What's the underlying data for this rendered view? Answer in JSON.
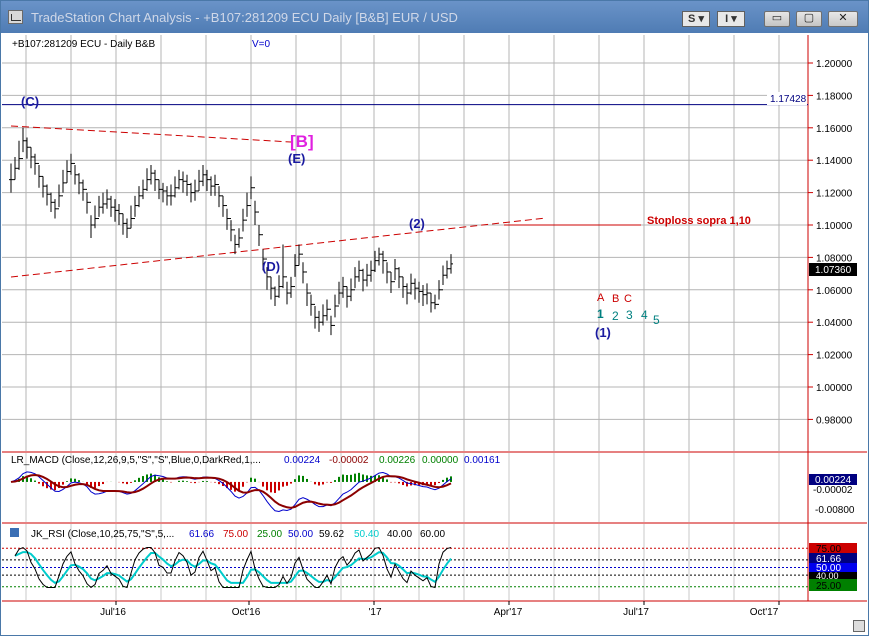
{
  "window": {
    "title": "TradeStation Chart Analysis - +B107:281209 ECU Daily [B&B] EUR / USD",
    "btn_s": "S",
    "btn_i": "I",
    "btn_min": "▭",
    "btn_max": "▢",
    "btn_close": "✕"
  },
  "colors": {
    "grid": "#b0b0b0",
    "price_bars": "#000000",
    "resistance": "#000080",
    "trendline": "#cc0000",
    "wave_label": "#1a1aa0",
    "wave_b": "#e020e0",
    "teal": "#008080",
    "red_label": "#cc0000"
  },
  "chart_data": [
    {
      "type": "ohlc",
      "panel": "price",
      "header": {
        "symbol": "+B107:281209 ECU - Daily  B&B",
        "v": "V=0"
      },
      "yaxis": {
        "ticks": [
          "1.20000",
          "1.18000",
          "1.16000",
          "1.14000",
          "1.12000",
          "1.10000",
          "1.08000",
          "1.06000",
          "1.04000",
          "1.02000",
          "1.00000",
          "0.98000"
        ],
        "ylim": [
          0.968,
          1.218
        ]
      },
      "xaxis": {
        "ticks": [
          "Jul'16",
          "Oct'16",
          "'17",
          "Apr'17",
          "Jul'17",
          "Oct'17"
        ]
      },
      "grid": true,
      "series": {
        "x": [
          0,
          2,
          4,
          6,
          8,
          10,
          12,
          14,
          16,
          18,
          20,
          22,
          24,
          26,
          28,
          30,
          32,
          34,
          36,
          38,
          40,
          42,
          44,
          46,
          48,
          50,
          52,
          54,
          56,
          58,
          60,
          62,
          64,
          66,
          68,
          70,
          72,
          74,
          76,
          78,
          80,
          82,
          84,
          86,
          88,
          90,
          92,
          94,
          96,
          98,
          100,
          102,
          104,
          106,
          108,
          110,
          112,
          114,
          116,
          118,
          120,
          122,
          124,
          126,
          128,
          130,
          132,
          134,
          136,
          138,
          140,
          142,
          144,
          146,
          148,
          150,
          152,
          154,
          156,
          158,
          160,
          162,
          164,
          166,
          168,
          170,
          172,
          174,
          176,
          178,
          180,
          182,
          184,
          186,
          188,
          190,
          192,
          194,
          196,
          198,
          200,
          202,
          204,
          206,
          208,
          210,
          212,
          214,
          216,
          218,
          220,
          222,
          224,
          226,
          228,
          230,
          232,
          234,
          236,
          238
        ],
        "close": [
          1.128,
          1.135,
          1.141,
          1.152,
          1.148,
          1.142,
          1.138,
          1.13,
          1.124,
          1.119,
          1.114,
          1.11,
          1.118,
          1.126,
          1.133,
          1.138,
          1.131,
          1.126,
          1.122,
          1.114,
          1.1,
          1.104,
          1.111,
          1.113,
          1.116,
          1.111,
          1.109,
          1.107,
          1.101,
          1.098,
          1.104,
          1.112,
          1.118,
          1.122,
          1.128,
          1.132,
          1.128,
          1.122,
          1.121,
          1.118,
          1.118,
          1.123,
          1.128,
          1.127,
          1.125,
          1.12,
          1.121,
          1.127,
          1.131,
          1.128,
          1.124,
          1.125,
          1.118,
          1.112,
          1.104,
          1.097,
          1.088,
          1.092,
          1.103,
          1.112,
          1.123,
          1.108,
          1.094,
          1.079,
          1.068,
          1.061,
          1.056,
          1.062,
          1.068,
          1.058,
          1.062,
          1.075,
          1.082,
          1.071,
          1.058,
          1.051,
          1.043,
          1.04,
          1.044,
          1.048,
          1.038,
          1.05,
          1.058,
          1.062,
          1.056,
          1.06,
          1.068,
          1.072,
          1.066,
          1.069,
          1.072,
          1.078,
          1.082,
          1.078,
          1.071,
          1.065,
          1.073,
          1.068,
          1.062,
          1.058,
          1.064,
          1.061,
          1.059,
          1.057,
          1.058,
          1.052,
          1.051,
          1.06,
          1.069,
          1.073,
          1.076
        ],
        "high": [
          1.138,
          1.142,
          1.152,
          1.16,
          1.154,
          1.148,
          1.144,
          1.137,
          1.13,
          1.125,
          1.12,
          1.116,
          1.125,
          1.134,
          1.14,
          1.144,
          1.137,
          1.132,
          1.128,
          1.12,
          1.106,
          1.112,
          1.118,
          1.12,
          1.122,
          1.118,
          1.116,
          1.113,
          1.107,
          1.104,
          1.112,
          1.118,
          1.124,
          1.128,
          1.135,
          1.137,
          1.134,
          1.128,
          1.126,
          1.124,
          1.125,
          1.13,
          1.134,
          1.133,
          1.131,
          1.126,
          1.128,
          1.134,
          1.137,
          1.134,
          1.13,
          1.131,
          1.124,
          1.118,
          1.11,
          1.103,
          1.094,
          1.098,
          1.11,
          1.12,
          1.13,
          1.115,
          1.1,
          1.085,
          1.074,
          1.068,
          1.062,
          1.069,
          1.088,
          1.065,
          1.068,
          1.082,
          1.088,
          1.077,
          1.064,
          1.057,
          1.05,
          1.047,
          1.051,
          1.054,
          1.044,
          1.057,
          1.065,
          1.068,
          1.062,
          1.067,
          1.074,
          1.078,
          1.073,
          1.076,
          1.078,
          1.084,
          1.086,
          1.084,
          1.077,
          1.071,
          1.079,
          1.074,
          1.068,
          1.064,
          1.07,
          1.067,
          1.065,
          1.063,
          1.064,
          1.058,
          1.057,
          1.066,
          1.075,
          1.078,
          1.082
        ],
        "low": [
          1.12,
          1.128,
          1.134,
          1.145,
          1.141,
          1.135,
          1.131,
          1.123,
          1.117,
          1.112,
          1.108,
          1.104,
          1.111,
          1.12,
          1.126,
          1.131,
          1.125,
          1.119,
          1.115,
          1.107,
          1.092,
          1.098,
          1.105,
          1.107,
          1.11,
          1.105,
          1.102,
          1.1,
          1.094,
          1.092,
          1.098,
          1.105,
          1.111,
          1.116,
          1.121,
          1.125,
          1.121,
          1.116,
          1.114,
          1.112,
          1.112,
          1.117,
          1.122,
          1.12,
          1.118,
          1.114,
          1.115,
          1.121,
          1.124,
          1.121,
          1.118,
          1.118,
          1.111,
          1.105,
          1.097,
          1.09,
          1.082,
          1.086,
          1.096,
          1.105,
          1.116,
          1.1,
          1.087,
          1.072,
          1.06,
          1.054,
          1.05,
          1.055,
          1.061,
          1.051,
          1.055,
          1.068,
          1.075,
          1.064,
          1.05,
          1.044,
          1.036,
          1.034,
          1.038,
          1.041,
          1.032,
          1.043,
          1.051,
          1.055,
          1.049,
          1.053,
          1.061,
          1.065,
          1.059,
          1.062,
          1.065,
          1.071,
          1.075,
          1.07,
          1.064,
          1.058,
          1.066,
          1.061,
          1.055,
          1.051,
          1.057,
          1.054,
          1.052,
          1.05,
          1.051,
          1.046,
          1.048,
          1.054,
          1.063,
          1.067,
          1.07
        ]
      },
      "price_label": "1.17428",
      "last_price": "1.07360",
      "resistance_level": 1.17428,
      "stop_level": 1.1,
      "annotations": {
        "c": "(C)",
        "b": "[B]",
        "e": "(E)",
        "d": "(D)",
        "w2": "(2)",
        "stoploss": "Stoploss sopra 1,10",
        "abc_a": "A",
        "abc_b": "B",
        "abc_c": "C",
        "n1": "1",
        "n2": "2",
        "n3": "3",
        "n4": "4",
        "n5": "5",
        "w1": "(1)"
      }
    },
    {
      "type": "line",
      "panel": "macd",
      "header": {
        "name": "LR_MACD (Close,12,26,9,5,\"S\",\"S\",Blue,0,DarkRed,1,...",
        "v1": "0.00224",
        "v2": "-0.00002",
        "v3": "0.00226",
        "v4": "0.00000",
        "v5": "0.00161"
      },
      "yaxis": {
        "ticks": [
          "-0.00800"
        ],
        "ylim": [
          -0.0115,
          0.004
        ]
      },
      "labels": {
        "hi": "0.00224",
        "lo": "-0.00002"
      }
    },
    {
      "type": "line",
      "panel": "rsi",
      "header": {
        "name": "JK_RSI (Close,10,25,75,\"S\",5,...",
        "v1": "61.66",
        "v2": "75.00",
        "v3": "25.00",
        "v4": "50.00",
        "v5": "59.62",
        "v6": "50.40",
        "v7": "40.00",
        "v8": "60.00"
      },
      "yaxis": {
        "ylim": [
          20,
          82
        ]
      },
      "labels": {
        "l75": "75.00",
        "l61": "61.66",
        "l50": "50.00",
        "l40": "40.00",
        "l25": "25.00"
      }
    }
  ]
}
